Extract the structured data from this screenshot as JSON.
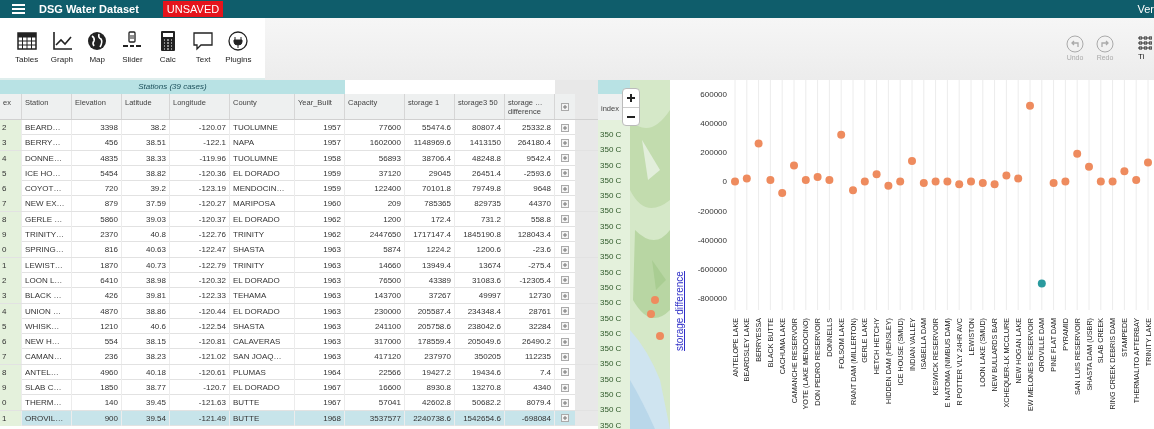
{
  "top_bar": {
    "title": "DSG Water Dataset",
    "badge": "UNSAVED",
    "version": "Ver"
  },
  "toolbar": {
    "tools": [
      {
        "label": "Tables",
        "kind": "table"
      },
      {
        "label": "Graph",
        "kind": "graph"
      },
      {
        "label": "Map"
      },
      {
        "label": "Slider",
        "kind": "slider"
      },
      {
        "label": "Calc",
        "kind": "calc"
      },
      {
        "label": "Text",
        "kind": "text"
      },
      {
        "label": "Plugins",
        "kind": "plugins"
      }
    ],
    "undo": {
      "label": "Undo",
      "disabled": true
    },
    "redo": {
      "label": "Redo",
      "disabled": true
    },
    "tile": {
      "label": "Ti"
    }
  },
  "case_table": {
    "title": "Stations (39 cases)",
    "columns": [
      "ex",
      "Station",
      "Elevation",
      "Latitude",
      "Longitude",
      "County",
      "Year_Built",
      "Capacity",
      "storage 1",
      "storage3 50",
      "storage … difference"
    ],
    "rows": [
      {
        "cells": [
          "2",
          "BEARD…",
          "3398",
          "38.2",
          "-120.07",
          "TUOLUMNE",
          "1957",
          "77600",
          "55474.6",
          "80807.4",
          "25332.8"
        ],
        "selected": false
      },
      {
        "cells": [
          "3",
          "BERRY…",
          "456",
          "38.51",
          "-122.1",
          "NAPA",
          "1957",
          "1602000",
          "1148969.6",
          "1413150",
          "264180.4"
        ],
        "selected": false
      },
      {
        "cells": [
          "4",
          "DONNE…",
          "4835",
          "38.33",
          "-119.96",
          "TUOLUMNE",
          "1958",
          "56893",
          "38706.4",
          "48248.8",
          "9542.4"
        ],
        "selected": false
      },
      {
        "cells": [
          "5",
          "ICE HO…",
          "5454",
          "38.82",
          "-120.36",
          "EL DORADO",
          "1959",
          "37120",
          "29045",
          "26451.4",
          "-2593.6"
        ],
        "selected": false
      },
      {
        "cells": [
          "6",
          "COYOT…",
          "720",
          "39.2",
          "-123.19",
          "MENDOCIN…",
          "1959",
          "122400",
          "70101.8",
          "79749.8",
          "9648"
        ],
        "selected": false
      },
      {
        "cells": [
          "7",
          "NEW EX…",
          "879",
          "37.59",
          "-120.27",
          "MARIPOSA",
          "1960",
          "209",
          "785365",
          "829735",
          "44370"
        ],
        "selected": false
      },
      {
        "cells": [
          "8",
          "GERLE …",
          "5860",
          "39.03",
          "-120.37",
          "EL DORADO",
          "1962",
          "1200",
          "172.4",
          "731.2",
          "558.8"
        ],
        "selected": false
      },
      {
        "cells": [
          "9",
          "TRINITY…",
          "2370",
          "40.8",
          "-122.76",
          "TRINITY",
          "1962",
          "2447650",
          "1717147.4",
          "1845190.8",
          "128043.4"
        ],
        "selected": false
      },
      {
        "cells": [
          "0",
          "SPRING…",
          "816",
          "40.63",
          "-122.47",
          "SHASTA",
          "1963",
          "5874",
          "1224.2",
          "1200.6",
          "-23.6"
        ],
        "selected": false
      },
      {
        "cells": [
          "1",
          "LEWIST…",
          "1870",
          "40.73",
          "-122.79",
          "TRINITY",
          "1963",
          "14660",
          "13949.4",
          "13674",
          "-275.4"
        ],
        "selected": false
      },
      {
        "cells": [
          "2",
          "LOON L…",
          "6410",
          "38.98",
          "-120.32",
          "EL DORADO",
          "1963",
          "76500",
          "43389",
          "31083.6",
          "-12305.4"
        ],
        "selected": false
      },
      {
        "cells": [
          "3",
          "BLACK …",
          "426",
          "39.81",
          "-122.33",
          "TEHAMA",
          "1963",
          "143700",
          "37267",
          "49997",
          "12730"
        ],
        "selected": false
      },
      {
        "cells": [
          "4",
          "UNION …",
          "4870",
          "38.86",
          "-120.44",
          "EL DORADO",
          "1963",
          "230000",
          "205587.4",
          "234348.4",
          "28761"
        ],
        "selected": false
      },
      {
        "cells": [
          "5",
          "WHISK…",
          "1210",
          "40.6",
          "-122.54",
          "SHASTA",
          "1963",
          "241100",
          "205758.6",
          "238042.6",
          "32284"
        ],
        "selected": false
      },
      {
        "cells": [
          "6",
          "NEW H…",
          "554",
          "38.15",
          "-120.81",
          "CALAVERAS",
          "1963",
          "317000",
          "178559.4",
          "205049.6",
          "26490.2"
        ],
        "selected": false
      },
      {
        "cells": [
          "7",
          "CAMAN…",
          "236",
          "38.23",
          "-121.02",
          "SAN JOAQ…",
          "1963",
          "417120",
          "237970",
          "350205",
          "112235"
        ],
        "selected": false
      },
      {
        "cells": [
          "8",
          "ANTEL…",
          "4960",
          "40.18",
          "-120.61",
          "PLUMAS",
          "1964",
          "22566",
          "19427.2",
          "19434.6",
          "7.4"
        ],
        "selected": false
      },
      {
        "cells": [
          "9",
          "SLAB C…",
          "1850",
          "38.77",
          "-120.7",
          "EL DORADO",
          "1967",
          "16600",
          "8930.8",
          "13270.8",
          "4340"
        ],
        "selected": false
      },
      {
        "cells": [
          "0",
          "THERM…",
          "140",
          "39.45",
          "-121.63",
          "BUTTE",
          "1967",
          "57041",
          "42602.8",
          "50682.2",
          "8079.4"
        ],
        "selected": false
      },
      {
        "cells": [
          "1",
          "OROVIL…",
          "900",
          "39.54",
          "-121.49",
          "BUTTE",
          "1968",
          "3537577",
          "2240738.6",
          "1542654.6",
          "-698084"
        ],
        "selected": true
      }
    ]
  },
  "index_table": {
    "column": "index",
    "cells": [
      "350 C",
      "350 C",
      "350 C",
      "350 C",
      "350 C",
      "350 C",
      "350 C",
      "350 C",
      "350 C",
      "350 C",
      "350 C",
      "350 C",
      "350 C",
      "350 C",
      "350 C",
      "350 C",
      "350 C",
      "350 C",
      "350 C",
      "350 C"
    ]
  },
  "graph": {
    "chart_data": {
      "type": "scatter",
      "ylabel": "storage difference",
      "categories": [
        "ANTELOPE LAKE",
        "BEARDSLEY LAKE",
        "BERRYESSA",
        "BLACK BUTTE",
        "CACHUMA LAKE",
        "CAMANCHE RESERVOIR",
        "YOTE (LAKE MENDOCINO)",
        "DON PEDRO RESERVOIR",
        "DONNELLS",
        "FOLSOM LAKE",
        "RIANT DAM (MILLERTON)",
        "GERLE LAKE",
        "HETCH HETCHY",
        "HIDDEN DAM (HENSLEY)",
        "ICE HOUSE (SMUD)",
        "INDIAN VALLEY",
        "ISABELLA DAM",
        "KESWICK RESERVOIR",
        "E NATOMA (NIMBUS DAM)",
        "R POTTER VLY 24HR AVC",
        "LEWISTON",
        "LOON LAKE (SMUD)",
        "NEW BULLARDS BAR",
        "XCHEQUER-LK MCCLURE",
        "NEW HOGAN LAKE",
        "EW MELONES RESERVOIR",
        "OROVILLE DAM",
        "PINE FLAT DAM",
        "PYRAMID",
        "SAN LUIS RESERVOIR",
        "SHASTA DAM (USBR)",
        "SLAB CREEK",
        "RING CREEK DEBRIS DAM",
        "STAMPEDE",
        "THERMALITO AFTERBAY",
        "TRINITY LAKE"
      ],
      "series": [
        {
          "color": "#ee8b5e",
          "values": [
            0,
            20000,
            260000,
            10000,
            -80000,
            110000,
            10000,
            30000,
            10000,
            320000,
            -60000,
            0,
            50000,
            -30000,
            0,
            140000,
            -10000,
            0,
            0,
            -20000,
            0,
            -10000,
            -20000,
            40000,
            20000,
            520000,
            null,
            -10000,
            0,
            190000,
            100000,
            0,
            0,
            70000,
            10000,
            130000
          ]
        },
        {
          "color": "#2a9a9e",
          "values": [
            null,
            null,
            null,
            null,
            null,
            null,
            null,
            null,
            null,
            null,
            null,
            null,
            null,
            null,
            null,
            null,
            null,
            null,
            null,
            null,
            null,
            null,
            null,
            null,
            null,
            null,
            -700000,
            null,
            null,
            null,
            null,
            null,
            null,
            null,
            null,
            null
          ]
        }
      ],
      "ylim": [
        -800000,
        600000
      ],
      "grid": true,
      "yticks": [
        600000,
        400000,
        200000,
        0,
        -200000,
        -400000,
        -600000,
        -800000
      ]
    }
  }
}
